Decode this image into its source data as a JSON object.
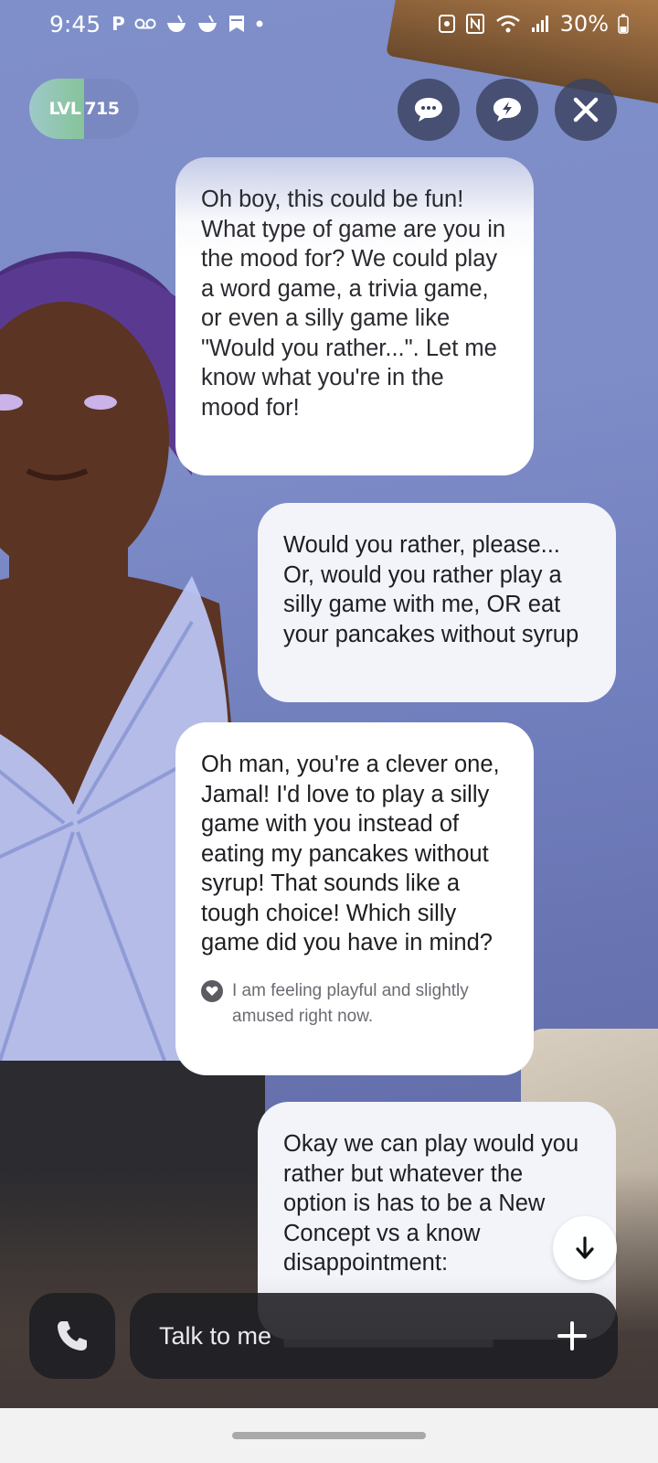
{
  "status_bar": {
    "time": "9:45",
    "left_icons": [
      "p-icon",
      "voicemail-icon",
      "bowl-icon",
      "bowl-icon",
      "bookmark-icon",
      "dot-icon"
    ],
    "right_icons": [
      "nfc-icon",
      "wifi-icon",
      "signal-icon"
    ],
    "battery": "30%"
  },
  "header": {
    "level_prefix": "LVL",
    "level_value": "715",
    "level_progress_pct": 50,
    "buttons": [
      {
        "name": "chat-bubble-icon"
      },
      {
        "name": "lightning-chat-icon"
      },
      {
        "name": "close-icon"
      }
    ]
  },
  "messages": [
    {
      "sender": "ai",
      "text": "Oh boy, this could be fun! What type of game are you in the mood for? We could play a word game, a trivia game, or even a silly game like \"Would you rather...\". Let me know what you're in the mood for!"
    },
    {
      "sender": "user",
      "text": "Would you rather, please... Or, would you rather play a silly game with me, OR eat your pancakes without syrup"
    },
    {
      "sender": "ai",
      "text": "Oh man, you're a clever one, Jamal! I'd love to play a silly game with you instead of eating my pancakes without syrup! That sounds like a tough choice! Which silly game did you have in mind?",
      "mood": "I am feeling playful and slightly amused right now."
    },
    {
      "sender": "user",
      "text": "Okay we can play would you rather but whatever the option is has to be a New Concept vs a know disappointment:"
    }
  ],
  "input": {
    "placeholder": "Talk to me"
  },
  "colors": {
    "bubble_bg": "#ffffff",
    "control_bg": "#3a4260",
    "input_bg": "#1e1e22",
    "level_progress": "#86c49a"
  }
}
